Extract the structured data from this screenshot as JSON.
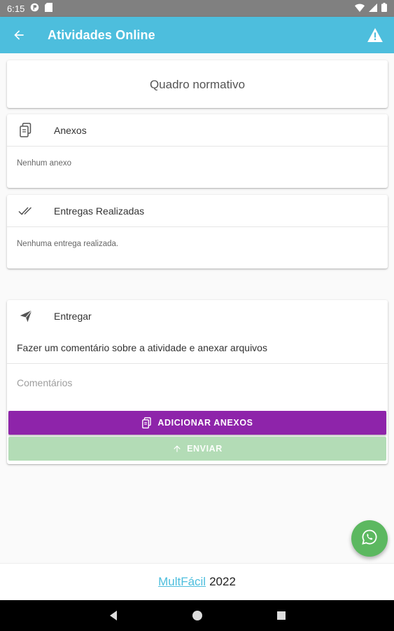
{
  "status_bar": {
    "time": "6:15"
  },
  "app_bar": {
    "title": "Atividades Online"
  },
  "quadro": {
    "title": "Quadro normativo"
  },
  "anexos": {
    "title": "Anexos",
    "empty_text": "Nenhum anexo"
  },
  "entregas": {
    "title": "Entregas Realizadas",
    "empty_text": "Nenhuma entrega realizada."
  },
  "entregar": {
    "title": "Entregar",
    "description": "Fazer um comentário sobre a atividade e anexar arquivos",
    "comment_placeholder": "Comentários",
    "add_button": "ADICIONAR ANEXOS",
    "send_button": "ENVIAR"
  },
  "footer": {
    "brand": "MultFácil",
    "year": "2022"
  },
  "colors": {
    "primary": "#4dbedd",
    "add_button": "#8e24aa",
    "send_button_disabled": "#b3dcb6",
    "fab": "#5cb860"
  }
}
